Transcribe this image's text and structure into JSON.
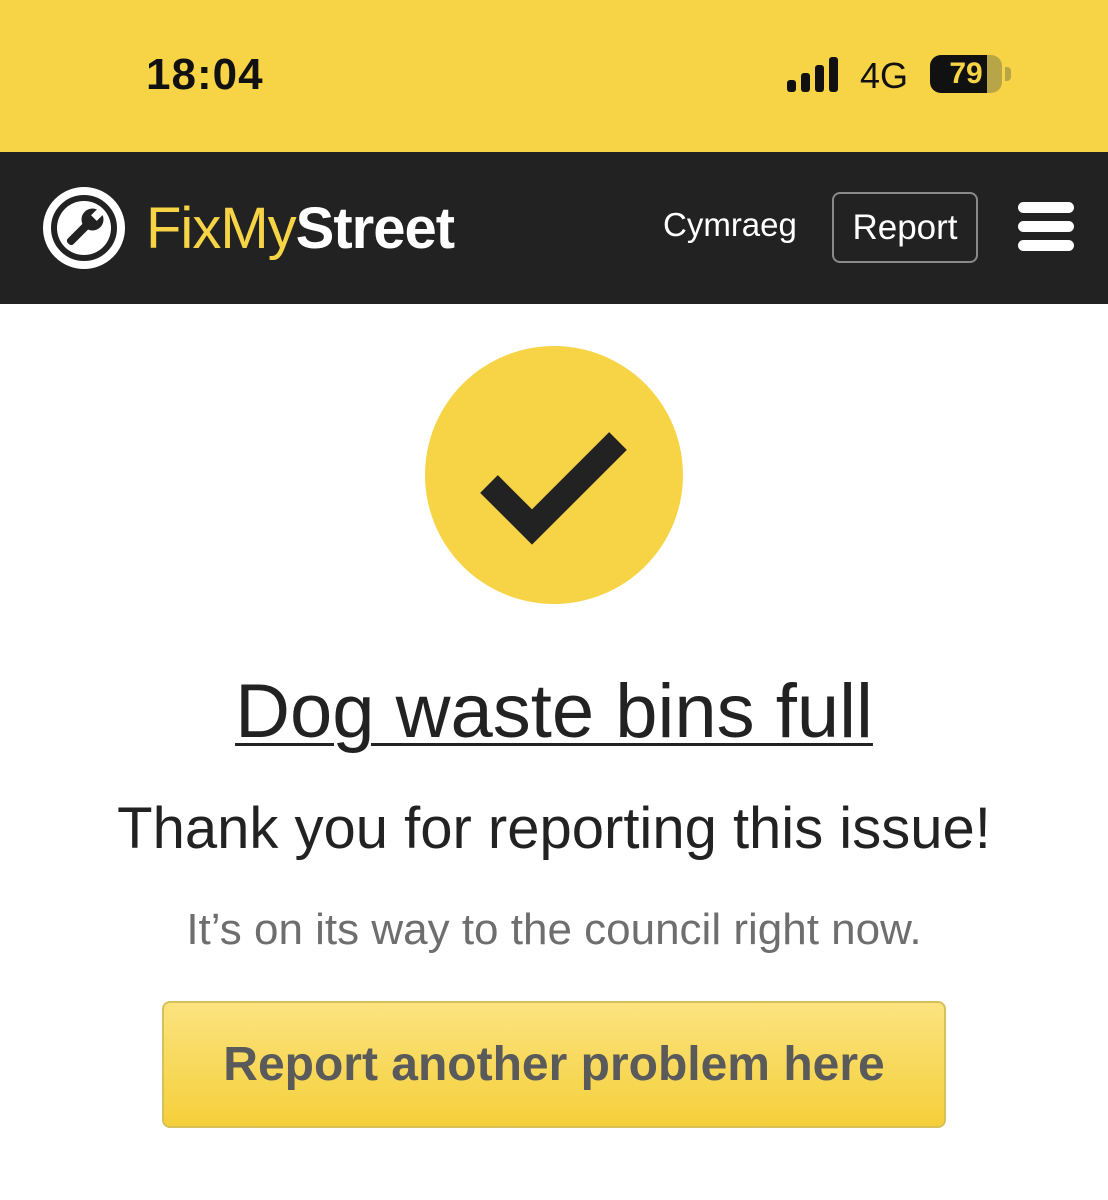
{
  "status_bar": {
    "time": "18:04",
    "network": "4G",
    "battery_percent": "79",
    "battery_level": 0.79,
    "signal_bars": 4
  },
  "header": {
    "logo_part1": "FixMy",
    "logo_part2": "Street",
    "language_link": "Cymraeg",
    "report_button": "Report",
    "menu_icon": "hamburger-menu-icon"
  },
  "confirmation": {
    "icon": "checkmark-icon",
    "report_title": "Dog waste bins full",
    "thanks_message": "Thank you for reporting this issue!",
    "sub_message": "It’s on its way to the council right now.",
    "cta_button": "Report another problem here"
  },
  "colors": {
    "brand_yellow": "#f7d346",
    "nav_background": "#222222",
    "text_dark": "#222222",
    "text_muted": "#6e6e6e"
  }
}
